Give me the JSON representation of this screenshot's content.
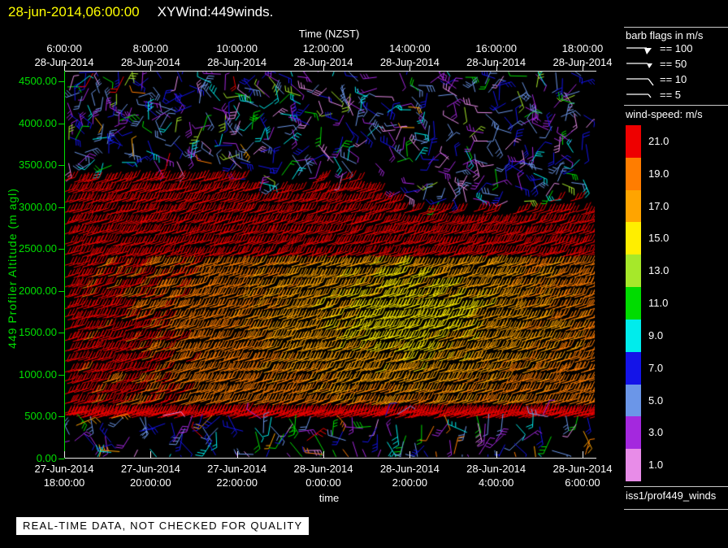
{
  "header": {
    "datetime": "28-jun-2014,06:00:00",
    "plot_name": "XYWind:449winds."
  },
  "top_axis": {
    "title": "Time (NZST)",
    "labels": [
      {
        "time": "6:00:00",
        "date": "28-Jun-2014"
      },
      {
        "time": "8:00:00",
        "date": "28-Jun-2014"
      },
      {
        "time": "10:00:00",
        "date": "28-Jun-2014"
      },
      {
        "time": "12:00:00",
        "date": "28-Jun-2014"
      },
      {
        "time": "14:00:00",
        "date": "28-Jun-2014"
      },
      {
        "time": "16:00:00",
        "date": "28-Jun-2014"
      },
      {
        "time": "18:00:00",
        "date": "28-Jun-2014"
      }
    ]
  },
  "left_axis": {
    "title": "449 Profiler Altitude (m agl)",
    "ticks": [
      "4500.00",
      "4000.00",
      "3500.00",
      "3000.00",
      "2500.00",
      "2000.00",
      "1500.00",
      "1000.00",
      "500.00",
      "0.00"
    ]
  },
  "bottom_axis": {
    "title": "time",
    "labels": [
      {
        "date": "27-Jun-2014",
        "time": "18:00:00"
      },
      {
        "date": "27-Jun-2014",
        "time": "20:00:00"
      },
      {
        "date": "27-Jun-2014",
        "time": "22:00:00"
      },
      {
        "date": "28-Jun-2014",
        "time": "0:00:00"
      },
      {
        "date": "28-Jun-2014",
        "time": "2:00:00"
      },
      {
        "date": "28-Jun-2014",
        "time": "4:00:00"
      },
      {
        "date": "28-Jun-2014",
        "time": "6:00:00"
      }
    ]
  },
  "barb_legend": {
    "title": "barb flags in m/s",
    "entries": [
      {
        "symbol": "pennant-large",
        "label": "== 100"
      },
      {
        "symbol": "pennant-small",
        "label": "== 50"
      },
      {
        "symbol": "full-tick",
        "label": "== 10"
      },
      {
        "symbol": "half-tick",
        "label": "== 5"
      }
    ]
  },
  "colorbar": {
    "title": "wind-speed: m/s",
    "entries": [
      {
        "value": "21.0",
        "color": "#ee0000"
      },
      {
        "value": "19.0",
        "color": "#ff7d00"
      },
      {
        "value": "17.0",
        "color": "#ffa400"
      },
      {
        "value": "15.0",
        "color": "#ffee00"
      },
      {
        "value": "13.0",
        "color": "#a6e82a"
      },
      {
        "value": "11.0",
        "color": "#00dc00"
      },
      {
        "value": "9.0",
        "color": "#00ecec"
      },
      {
        "value": "7.0",
        "color": "#1414e8"
      },
      {
        "value": "5.0",
        "color": "#6b96e8"
      },
      {
        "value": "3.0",
        "color": "#a428de"
      },
      {
        "value": "1.0",
        "color": "#e88ce8"
      }
    ]
  },
  "footer": {
    "source": "iss1/prof449_winds",
    "banner": "REAL-TIME DATA, NOT CHECKED FOR QUALITY"
  },
  "chart_data": {
    "type": "wind_barb_time_height",
    "title": "XYWind:449winds.",
    "valid_time": "28-jun-2014,06:00:00",
    "x_axis": {
      "bottom_label": "time",
      "bottom_ticks": [
        "27-Jun-2014 18:00:00",
        "27-Jun-2014 20:00:00",
        "27-Jun-2014 22:00:00",
        "28-Jun-2014 0:00:00",
        "28-Jun-2014 2:00:00",
        "28-Jun-2014 4:00:00",
        "28-Jun-2014 6:00:00"
      ],
      "top_label": "Time (NZST)",
      "top_ticks": [
        "28-Jun-2014 6:00:00",
        "28-Jun-2014 8:00:00",
        "28-Jun-2014 10:00:00",
        "28-Jun-2014 12:00:00",
        "28-Jun-2014 14:00:00",
        "28-Jun-2014 16:00:00",
        "28-Jun-2014 18:00:00"
      ]
    },
    "y_axis": {
      "label": "449 Profiler Altitude (m agl)",
      "range_m": [
        0,
        4500
      ],
      "ticks_m": [
        4500,
        4000,
        3500,
        3000,
        2500,
        2000,
        1500,
        1000,
        500,
        0
      ]
    },
    "speed_scale_ms": [
      21,
      19,
      17,
      15,
      13,
      11,
      9,
      7,
      5,
      3,
      1
    ],
    "barb_flag_values_ms": [
      100,
      50,
      10,
      5
    ],
    "wind_field_regions": [
      {
        "name": "upper-scattered",
        "alt_range_m": [
          3000,
          4550
        ],
        "speed_range_ms": [
          1,
          9
        ],
        "coverage": "scattered",
        "description": "light variable winds; sparse violet/purple/blue/cyan/green barbs"
      },
      {
        "name": "strong-wind-layer",
        "alt_range_m": [
          550,
          3430
        ],
        "speed_range_ms": [
          17,
          22
        ],
        "coverage": "dense-rows",
        "description": "continuous layer of strong winds drawn as dense red barb rows",
        "top_boundary_m_by_timefrac": [
          [
            0,
            3430
          ],
          [
            0.3,
            3430
          ],
          [
            0.36,
            3080
          ],
          [
            0.46,
            3330
          ],
          [
            0.57,
            3330
          ],
          [
            0.63,
            3000
          ],
          [
            0.8,
            2980
          ],
          [
            1,
            3040
          ]
        ]
      },
      {
        "name": "mid-level-speed-minimum",
        "alt_range_m": [
          1050,
          2400
        ],
        "speed_range_ms": [
          15,
          19
        ],
        "center_timefrac": 0.63,
        "description": "orange/yellow barbs embedded in the strong layer"
      },
      {
        "name": "near-surface-scattered",
        "alt_range_m": [
          60,
          550
        ],
        "speed_range_ms": [
          1,
          11
        ],
        "coverage": "scattered",
        "description": "light variable winds below the strong layer; mixed colors"
      }
    ]
  }
}
